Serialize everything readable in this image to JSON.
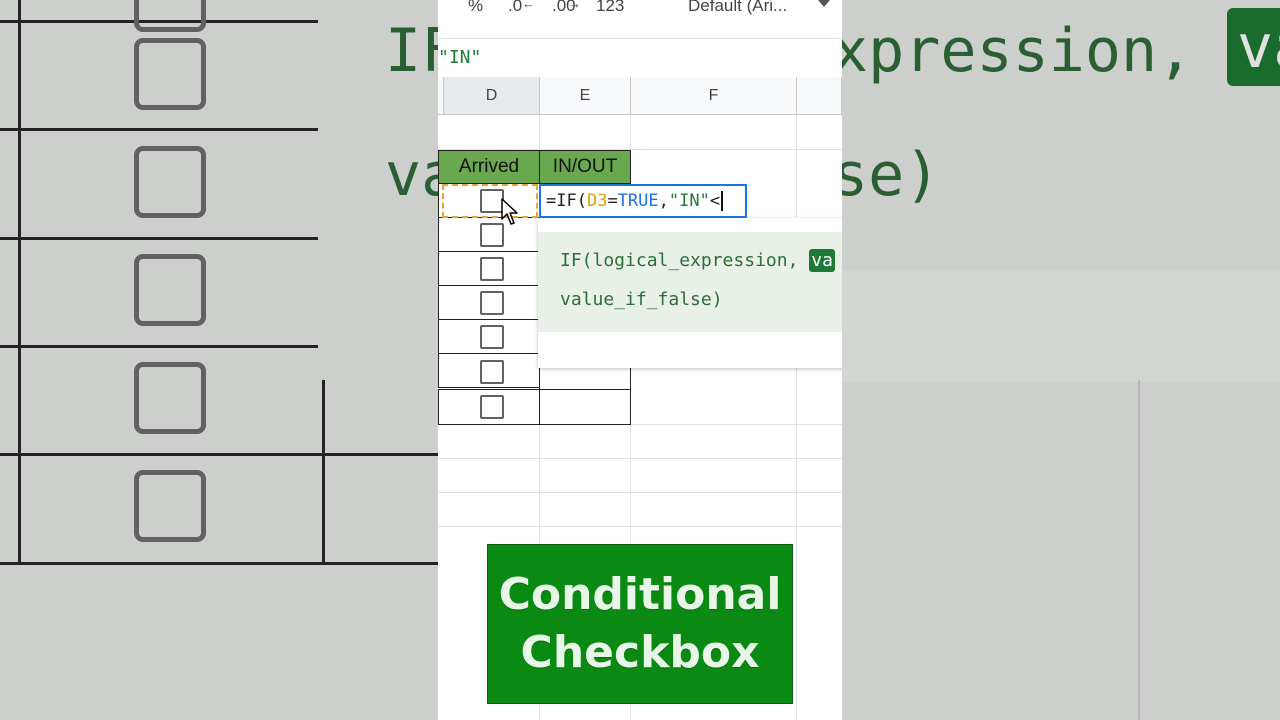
{
  "toolbar": {
    "percent": "%",
    "decrease_decimal": ".0",
    "increase_decimal": ".00",
    "number_format": "123",
    "font": "Default (Ari..."
  },
  "formula_bar": {
    "value": "\"IN\""
  },
  "columns": [
    "D",
    "E",
    "F"
  ],
  "table": {
    "headers": [
      "Arrived",
      "IN/OUT"
    ],
    "rows": 7
  },
  "editor": {
    "eq": "=IF(",
    "ref": "D3",
    "op": "=",
    "bool": "TRUE",
    "sep": ",",
    "str": "\"IN\"",
    "tail": "<"
  },
  "tooltip": {
    "line1": "IF(logical_expression, ",
    "highlight": "va",
    "line2": "value_if_false)"
  },
  "background": {
    "left_text": "IF",
    "left_text2": "va",
    "right_text": "xpression,",
    "right_text2": "se)",
    "right_badge": "va"
  },
  "banner": {
    "line1": "Conditional",
    "line2": "Checkbox"
  },
  "colors": {
    "header_green": "#6aa84f",
    "banner_green": "#0a8a12",
    "formula_blue": "#1a73e8"
  }
}
